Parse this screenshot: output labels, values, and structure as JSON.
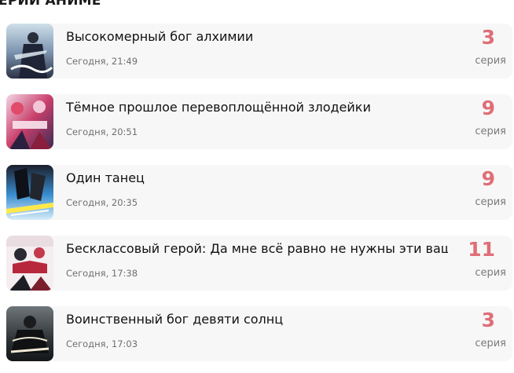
{
  "section": {
    "title": "ЕРИИ АНИМЕ"
  },
  "items": [
    {
      "title": "Высокомерный бог алхимии",
      "time": "Сегодня, 21:49",
      "episode": "3",
      "episode_label": "серия",
      "poster": "alchemy-god-poster"
    },
    {
      "title": "Тёмное прошлое перевоплощённой злодейки",
      "time": "Сегодня, 20:51",
      "episode": "9",
      "episode_label": "серия",
      "poster": "villainess-poster"
    },
    {
      "title": "Один танец",
      "time": "Сегодня, 20:35",
      "episode": "9",
      "episode_label": "серия",
      "poster": "one-dance-poster"
    },
    {
      "title": "Бесклассовый герой: Да мне всё равно не нужны эти ваши умения",
      "time": "Сегодня, 17:38",
      "episode": "11",
      "episode_label": "серия",
      "poster": "classless-hero-poster"
    },
    {
      "title": "Воинственный бог девяти солнц",
      "time": "Сегодня, 17:03",
      "episode": "3",
      "episode_label": "серия",
      "poster": "nine-suns-poster"
    }
  ],
  "colors": {
    "episode_accent": "#df6e77",
    "card_background": "#f7f7f7",
    "time_text": "#6f6f6f"
  }
}
